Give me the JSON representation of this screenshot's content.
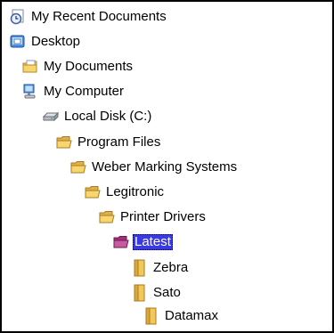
{
  "tree": {
    "items": [
      {
        "label": "My Recent Documents",
        "icon": "recent-documents-icon"
      },
      {
        "label": "Desktop",
        "icon": "desktop-icon"
      },
      {
        "label": "My Documents",
        "icon": "my-documents-icon"
      },
      {
        "label": "My Computer",
        "icon": "my-computer-icon"
      },
      {
        "label": "Local Disk (C:)",
        "icon": "local-disk-icon"
      },
      {
        "label": "Program Files",
        "icon": "folder-icon"
      },
      {
        "label": "Weber Marking Systems",
        "icon": "folder-icon"
      },
      {
        "label": "Legitronic",
        "icon": "folder-icon"
      },
      {
        "label": "Printer Drivers",
        "icon": "folder-icon"
      },
      {
        "label": "Latest",
        "icon": "folder-icon",
        "selected": true
      },
      {
        "label": "Zebra",
        "icon": "closed-folder-icon"
      },
      {
        "label": "Sato",
        "icon": "closed-folder-icon"
      },
      {
        "label": "Datamax",
        "icon": "closed-folder-icon"
      }
    ]
  },
  "colors": {
    "selection": "#3a3ae0",
    "folder": "#f2c75c",
    "border": "#000000"
  }
}
